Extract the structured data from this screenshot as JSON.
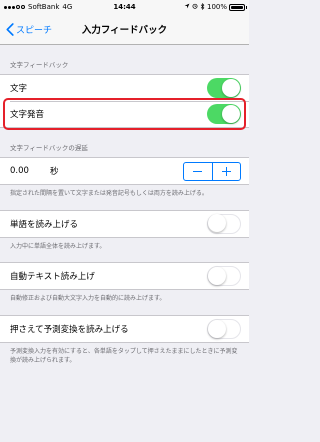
{
  "status_bar": {
    "carrier": "SoftBank",
    "network": "4G",
    "time": "14:44",
    "battery_percent": "100%"
  },
  "nav": {
    "back_label": "スピーチ",
    "title": "入力フィードバック"
  },
  "sections": {
    "text_feedback": {
      "header": "文字フィードバック",
      "rows": [
        {
          "label": "文字",
          "toggle": "on"
        },
        {
          "label": "文字発音",
          "toggle": "on"
        }
      ]
    },
    "delay": {
      "header": "文字フィードバックの遅延",
      "value": "0.00",
      "unit": "秒",
      "footer": "指定された間隔を置いて文字または発音記号もしくは両方を読み上げる。"
    },
    "words": {
      "label": "単語を読み上げる",
      "toggle": "off",
      "footer": "入力中に単語全体を読み上げます。"
    },
    "auto_text": {
      "label": "自動テキスト読み上げ",
      "toggle": "off",
      "footer": "自動修正および自動大文字入力を自動的に読み上げます。"
    },
    "hold_predictions": {
      "label": "押さえて予測変換を読み上げる",
      "toggle": "off",
      "footer": "予測変換入力を有効にすると、各単語をタップして押さえたままにしたときに予測変換が読み上げられます。"
    }
  },
  "colors": {
    "accent": "#007aff",
    "toggle_on": "#4cd964",
    "highlight": "#e5202a",
    "background": "#efeff4"
  }
}
